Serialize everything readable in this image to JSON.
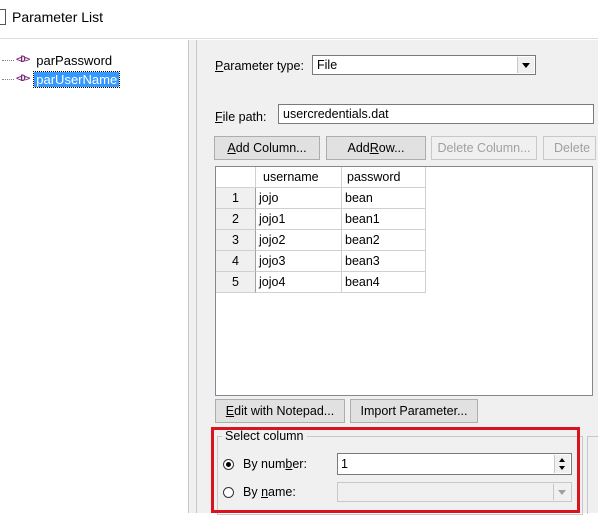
{
  "window": {
    "title": "Parameter List"
  },
  "tree": {
    "items": [
      {
        "icon": "<D>",
        "label": "parPassword",
        "selected": false
      },
      {
        "icon": "<D>",
        "label": "parUserName",
        "selected": true
      }
    ]
  },
  "parameter_type": {
    "label_u": "P",
    "label_rest": "arameter type:",
    "value": "File"
  },
  "file_path": {
    "label_u": "F",
    "label_rest": "ile path:",
    "value": "usercredentials.dat"
  },
  "toolbar": {
    "add_column_u": "A",
    "add_column_rest": "dd Column...",
    "add_row_pre": "Add ",
    "add_row_u": "R",
    "add_row_rest": "ow...",
    "delete_column": "Delete Column...",
    "delete_row": "Delete"
  },
  "grid": {
    "columns": [
      "username",
      "password"
    ],
    "rows": [
      {
        "num": "1",
        "username": "jojo",
        "password": "bean"
      },
      {
        "num": "2",
        "username": "jojo1",
        "password": "bean1"
      },
      {
        "num": "3",
        "username": "jojo2",
        "password": "bean2"
      },
      {
        "num": "4",
        "username": "jojo3",
        "password": "bean3"
      },
      {
        "num": "5",
        "username": "jojo4",
        "password": "bean4"
      }
    ]
  },
  "bottom_buttons": {
    "edit_u": "E",
    "edit_rest": "dit with Notepad...",
    "import": "Import Parameter..."
  },
  "select_column": {
    "legend": "Select column",
    "by_number_pre": "By num",
    "by_number_u": "b",
    "by_number_rest": "er:",
    "by_number_value": "1",
    "by_name_pre": "By ",
    "by_name_u": "n",
    "by_name_rest": "ame:",
    "by_name_value": ""
  },
  "colors": {
    "highlight": "#d8141f",
    "selection": "#3399ff"
  }
}
